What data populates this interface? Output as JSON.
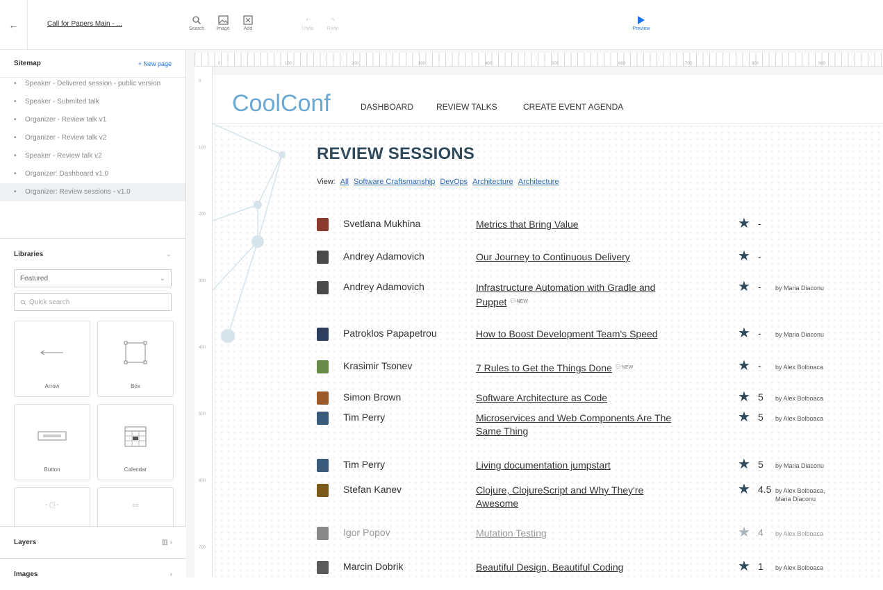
{
  "toolbar": {
    "back_icon": "arrow-left-icon",
    "doc_title": "Call for Papers Main - ...",
    "tools": [
      {
        "label": "Search",
        "icon": "search-icon"
      },
      {
        "label": "Image",
        "icon": "image-icon"
      },
      {
        "label": "Add",
        "icon": "add-box-icon"
      }
    ],
    "undo_label": "Undo",
    "redo_label": "Redo",
    "preview_label": "Preview"
  },
  "sitemap": {
    "title": "Sitemap",
    "new_page": "+ New page",
    "items": [
      {
        "label": "Speaker - Delivered session - public version",
        "selected": false
      },
      {
        "label": "Speaker - Submited talk",
        "selected": false
      },
      {
        "label": "Organizer - Review talk v1",
        "selected": false
      },
      {
        "label": "Organizer - Review talk v2",
        "selected": false
      },
      {
        "label": "Speaker - Review talk v2",
        "selected": false
      },
      {
        "label": "Organizer: Dashboard v1.0",
        "selected": false
      },
      {
        "label": "Organizer: Review sessions - v1.0",
        "selected": true
      }
    ]
  },
  "libraries": {
    "title": "Libraries",
    "selected": "Featured",
    "search_placeholder": "Quick search",
    "items": [
      {
        "label": "Arrow",
        "icon": "arrow-shape-icon"
      },
      {
        "label": "Box",
        "icon": "box-shape-icon"
      },
      {
        "label": "Button",
        "icon": "button-shape-icon"
      },
      {
        "label": "Calendar",
        "icon": "calendar-shape-icon"
      }
    ]
  },
  "bottom_panels": {
    "layers": "Layers",
    "images": "Images"
  },
  "ruler": {
    "top": [
      "0",
      "100",
      "200",
      "300",
      "400",
      "500",
      "600",
      "700",
      "800",
      "900"
    ],
    "left": [
      "0",
      "100",
      "200",
      "300",
      "400",
      "500",
      "600",
      "700"
    ]
  },
  "site": {
    "brand": "CoolConf",
    "nav": [
      "DASHBOARD",
      "REVIEW TALKS",
      "CREATE EVENT AGENDA"
    ],
    "heading": "REVIEW SESSIONS",
    "view_label": "View:",
    "filters": [
      "All",
      "Software Craftsmanship",
      "DevOps",
      "Architecture",
      "Architecture"
    ],
    "sessions": [
      {
        "speaker": "Svetlana Mukhina",
        "talk": "Metrics that Bring Value",
        "note": "",
        "rating": "-",
        "reviewer": "",
        "avatar_color": "#8a3b2e",
        "muted": false
      },
      {
        "speaker": "Andrey Adamovich",
        "talk": "Our Journey to Continuous Delivery",
        "note": "",
        "rating": "-",
        "reviewer": "",
        "avatar_color": "#4a4a4a",
        "muted": false
      },
      {
        "speaker": "Andrey Adamovich",
        "talk": "Infrastructure Automation with Gradle and Puppet",
        "note": "NEW",
        "rating": "-",
        "reviewer": "by Maria Diaconu",
        "avatar_color": "#4a4a4a",
        "muted": false
      },
      {
        "speaker": "Patroklos Papapetrou",
        "talk": "How to Boost Development Team's Speed",
        "note": "",
        "rating": "-",
        "reviewer": "by Maria Diaconu",
        "avatar_color": "#2e3e5e",
        "muted": false
      },
      {
        "speaker": "Krasimir Tsonev",
        "talk": "7 Rules to Get the Things Done",
        "note": "NEW",
        "rating": "-",
        "reviewer": "by Alex Bolboaca",
        "avatar_color": "#6a8a4a",
        "muted": false
      },
      {
        "speaker": "Simon Brown",
        "talk": "Software Architecture as Code",
        "note": "",
        "rating": "5",
        "reviewer": "by Alex Bolboaca",
        "avatar_color": "#9a5a2a",
        "muted": false
      },
      {
        "speaker": "Tim Perry",
        "talk": "Microservices and Web Components Are The Same Thing",
        "note": "",
        "rating": "5",
        "reviewer": "by Alex Bolboaca",
        "avatar_color": "#3a5a7a",
        "muted": false
      },
      {
        "speaker": "Tim Perry",
        "talk": "Living documentation jumpstart",
        "note": "",
        "rating": "5",
        "reviewer": "by Maria Diaconu",
        "avatar_color": "#3a5a7a",
        "muted": false
      },
      {
        "speaker": "Stefan Kanev",
        "talk": "Clojure, ClojureScript and Why They're Awesome",
        "note": "",
        "rating": "4.5",
        "reviewer": "by Alex Bolboaca, Maria Diaconu",
        "avatar_color": "#7a5a1a",
        "muted": false
      },
      {
        "speaker": "Igor Popov",
        "talk": "Mutation Testing",
        "note": "",
        "rating": "4",
        "reviewer": "by Alex Bolboaca",
        "avatar_color": "#8a8a8a",
        "muted": true
      },
      {
        "speaker": "Marcin Dobrik",
        "talk": "Beautiful Design, Beautiful Coding",
        "note": "",
        "rating": "1",
        "reviewer": "by Alex Bolboaca",
        "avatar_color": "#5a5a5a",
        "muted": false
      }
    ]
  },
  "colors": {
    "brand": "#6aa8d4",
    "heading": "#2f4a5c",
    "link": "#2d6bb3",
    "accent": "#1a73e8"
  }
}
